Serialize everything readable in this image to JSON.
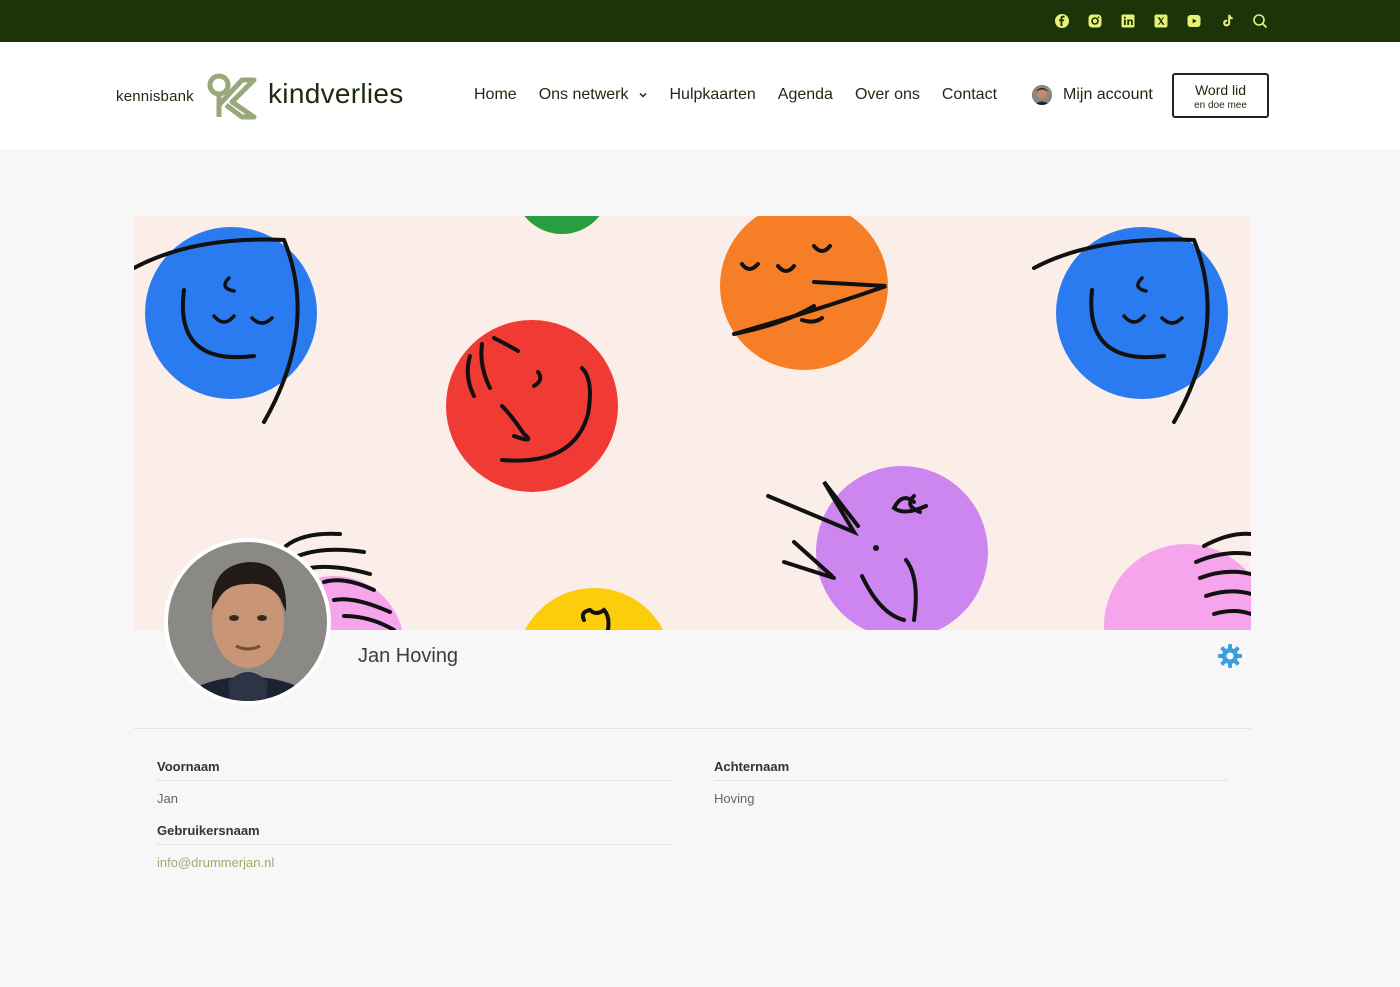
{
  "topbar": {
    "icons": [
      "facebook-icon",
      "instagram-icon",
      "linkedin-icon",
      "x-icon",
      "youtube-icon",
      "tiktok-icon",
      "search-icon"
    ],
    "bg_color": "#1b3408",
    "icon_color": "#e8f07a"
  },
  "brand": {
    "small": "kennisbank",
    "word": "kindverlies",
    "accent": "#9aa77a"
  },
  "nav": {
    "items": [
      {
        "label": "Home"
      },
      {
        "label": "Ons netwerk"
      },
      {
        "label": "Hulpkaarten"
      },
      {
        "label": "Agenda"
      },
      {
        "label": "Over ons"
      },
      {
        "label": "Contact"
      }
    ],
    "account_label": "Mijn account",
    "join_line1": "Word lid",
    "join_line2": "en doe mee"
  },
  "profile": {
    "name": "Jan Hoving",
    "gear_color": "#3a9ee0"
  },
  "fields": {
    "first_name_label": "Voornaam",
    "first_name_value": "Jan",
    "last_name_label": "Achternaam",
    "last_name_value": "Hoving",
    "username_label": "Gebruikersnaam",
    "username_value": "info@drummerjan.nl"
  }
}
